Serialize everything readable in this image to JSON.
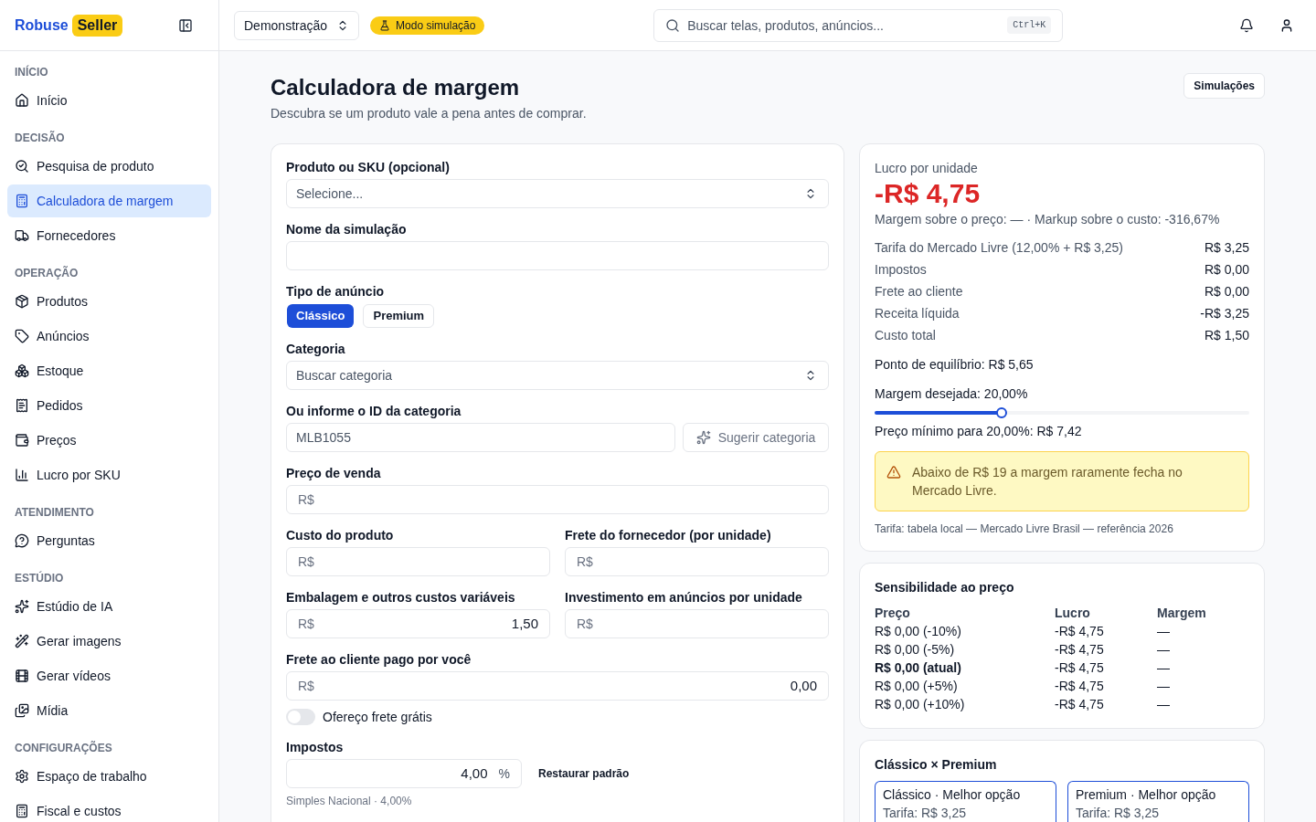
{
  "sidebar": {
    "brand": {
      "name": "Robuse",
      "badge": "Seller"
    },
    "sections": [
      {
        "title": "INÍCIO",
        "items": [
          {
            "label": "Início",
            "selected": false
          }
        ]
      },
      {
        "title": "DECISÃO",
        "items": [
          {
            "label": "Pesquisa de produto",
            "selected": false
          },
          {
            "label": "Calculadora de margem",
            "selected": true
          },
          {
            "label": "Fornecedores",
            "selected": false
          }
        ]
      },
      {
        "title": "OPERAÇÃO",
        "items": [
          {
            "label": "Produtos",
            "selected": false
          },
          {
            "label": "Anúncios",
            "selected": false
          },
          {
            "label": "Estoque",
            "selected": false
          },
          {
            "label": "Pedidos",
            "selected": false
          },
          {
            "label": "Preços",
            "selected": false
          },
          {
            "label": "Lucro por SKU",
            "selected": false
          }
        ]
      },
      {
        "title": "ATENDIMENTO",
        "items": [
          {
            "label": "Perguntas",
            "selected": false
          }
        ]
      },
      {
        "title": "ESTÚDIO",
        "items": [
          {
            "label": "Estúdio de IA",
            "selected": false
          },
          {
            "label": "Gerar imagens",
            "selected": false
          },
          {
            "label": "Gerar vídeos",
            "selected": false
          },
          {
            "label": "Mídia",
            "selected": false
          }
        ]
      },
      {
        "title": "CONFIGURAÇÕES",
        "items": [
          {
            "label": "Espaço de trabalho",
            "selected": false
          },
          {
            "label": "Fiscal e custos",
            "selected": false
          }
        ]
      }
    ]
  },
  "topbar": {
    "workspace": "Demonstração",
    "mode_badge": "Modo simulação",
    "search": {
      "placeholder": "Buscar telas, produtos, anúncios...",
      "shortcut": "Ctrl+K"
    }
  },
  "page": {
    "title": "Calculadora de margem",
    "subtitle": "Descubra se um produto vale a pena antes de comprar.",
    "action": "Simulações"
  },
  "form": {
    "rows": [
      {
        "kind": "select",
        "label": "Produto ou SKU (opcional)",
        "placeholder": "Selecione..."
      },
      {
        "kind": "text",
        "label": "Nome da simulação"
      },
      {
        "kind": "segmented",
        "label": "Tipo de anúncio",
        "options": [
          {
            "label": "Clássico",
            "selected": true
          },
          {
            "label": "Premium",
            "selected": false
          }
        ]
      },
      {
        "kind": "select",
        "label": "Categoria",
        "placeholder": "Buscar categoria"
      },
      {
        "kind": "text",
        "label": "Ou informe o ID da categoria",
        "placeholder": "MLB1055",
        "button": {
          "label": "Sugerir categoria",
          "disabled": true
        }
      },
      {
        "kind": "money",
        "fields": [
          {
            "label": "Preço de venda",
            "prefix": "R$"
          }
        ]
      },
      {
        "kind": "money",
        "fields": [
          {
            "label": "Custo do produto",
            "prefix": "R$"
          },
          {
            "label": "Frete do fornecedor (por unidade)",
            "prefix": "R$"
          }
        ]
      },
      {
        "kind": "money",
        "fields": [
          {
            "label": "Embalagem e outros custos variáveis",
            "prefix": "R$",
            "value": "1,50"
          },
          {
            "label": "Investimento em anúncios por unidade",
            "prefix": "R$"
          }
        ]
      },
      {
        "kind": "money",
        "fields": [
          {
            "label": "Frete ao cliente pago por você",
            "prefix": "R$",
            "value": "0,00"
          }
        ]
      },
      {
        "kind": "toggle",
        "label": "Ofereço frete grátis",
        "on": false
      },
      {
        "kind": "percent",
        "label": "Impostos",
        "value": "4,00",
        "suffix": "%",
        "button": "Restaurar padrão",
        "hint": "Simples Nacional · 4,00%"
      }
    ]
  },
  "result": {
    "label": "Lucro por unidade",
    "value": "-R$ 4,75",
    "negative": true,
    "ratios": "Margem sobre o preço: — · Markup sobre o custo: -316,67%",
    "breakdown": [
      {
        "label": "Tarifa do Mercado Livre (12,00% + R$ 3,25)",
        "value": "R$ 3,25"
      },
      {
        "label": "Impostos",
        "value": "R$ 0,00"
      },
      {
        "label": "Frete ao cliente",
        "value": "R$ 0,00"
      },
      {
        "label": "Receita líquida",
        "value": "-R$ 3,25"
      },
      {
        "label": "Custo total",
        "value": "R$ 1,50"
      }
    ],
    "break_even": "Ponto de equilíbrio: R$ 5,65",
    "target": {
      "label": "Margem desejada: 20,00%",
      "level": 0.34
    },
    "min_price": "Preço mínimo para 20,00%: R$ 7,42",
    "warning": "Abaixo de R$ 19 a margem raramente fecha no Mercado Livre.",
    "source": "Tarifa: tabela local — Mercado Livre Brasil — referência 2026"
  },
  "sensitivity": {
    "title": "Sensibilidade ao preço",
    "columns": [
      "Preço",
      "Lucro",
      "Margem"
    ],
    "rows": [
      {
        "cells": [
          "R$ 0,00 (-10%)",
          "-R$ 4,75",
          "—"
        ],
        "current": false
      },
      {
        "cells": [
          "R$ 0,00 (-5%)",
          "-R$ 4,75",
          "—"
        ],
        "current": false
      },
      {
        "cells": [
          "R$ 0,00 (atual)",
          "-R$ 4,75",
          "—"
        ],
        "current": true
      },
      {
        "cells": [
          "R$ 0,00 (+5%)",
          "-R$ 4,75",
          "—"
        ],
        "current": false
      },
      {
        "cells": [
          "R$ 0,00 (+10%)",
          "-R$ 4,75",
          "—"
        ],
        "current": false
      }
    ]
  },
  "comparison": {
    "title": "Clássico × Premium",
    "options": [
      {
        "title": "Clássico · Melhor opção",
        "fee": "Tarifa: R$ 3,25",
        "highlighted": true
      },
      {
        "title": "Premium · Melhor opção",
        "fee": "Tarifa: R$ 3,25",
        "highlighted": true
      }
    ]
  }
}
